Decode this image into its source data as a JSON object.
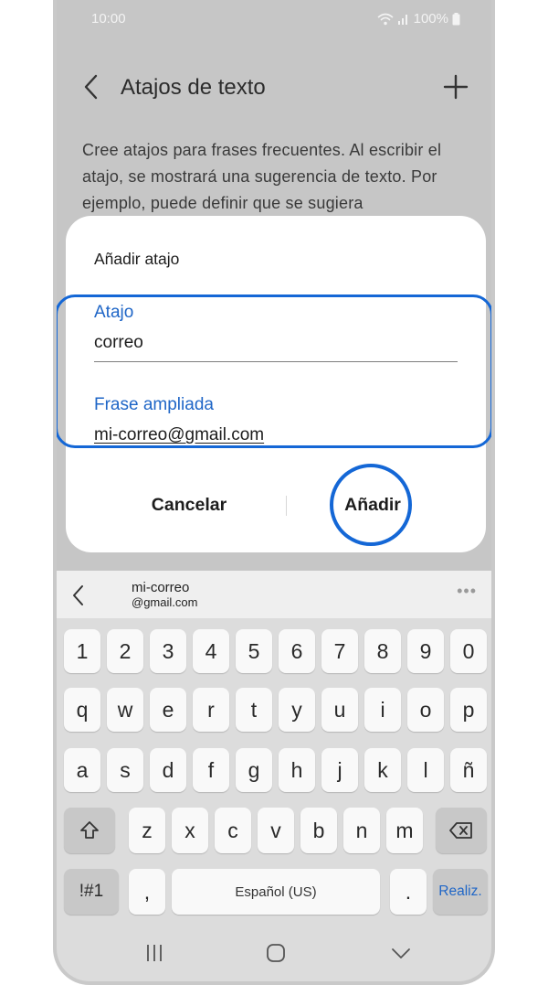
{
  "status_bar": {
    "time": "10:00",
    "battery": "100%"
  },
  "app_bar": {
    "title": "Atajos de texto"
  },
  "description": "Cree atajos para frases frecuentes. Al escribir el atajo, se mostrará una sugerencia de texto. Por ejemplo, puede definir que se sugiera",
  "dialog": {
    "title": "Añadir atajo",
    "shortcut_label": "Atajo",
    "shortcut_value": "correo",
    "phrase_label": "Frase ampliada",
    "phrase_value": "mi-correo@gmail.com",
    "cancel_label": "Cancelar",
    "add_label": "Añadir"
  },
  "keyboard": {
    "suggestion_line1": "mi-correo",
    "suggestion_line2": "@gmail.com",
    "suggestion_more": "•••",
    "row_numbers": [
      "1",
      "2",
      "3",
      "4",
      "5",
      "6",
      "7",
      "8",
      "9",
      "0"
    ],
    "row1": [
      "q",
      "w",
      "e",
      "r",
      "t",
      "y",
      "u",
      "i",
      "o",
      "p"
    ],
    "row2": [
      "a",
      "s",
      "d",
      "f",
      "g",
      "h",
      "j",
      "k",
      "l",
      "ñ"
    ],
    "row3": [
      "z",
      "x",
      "c",
      "v",
      "b",
      "n",
      "m"
    ],
    "symbols_label": "!#1",
    "comma_label": ",",
    "space_label": "Español (US)",
    "period_label": ".",
    "done_label": "Realiz."
  },
  "colors": {
    "accent": "#1f66c7",
    "highlight": "#1467d6"
  }
}
